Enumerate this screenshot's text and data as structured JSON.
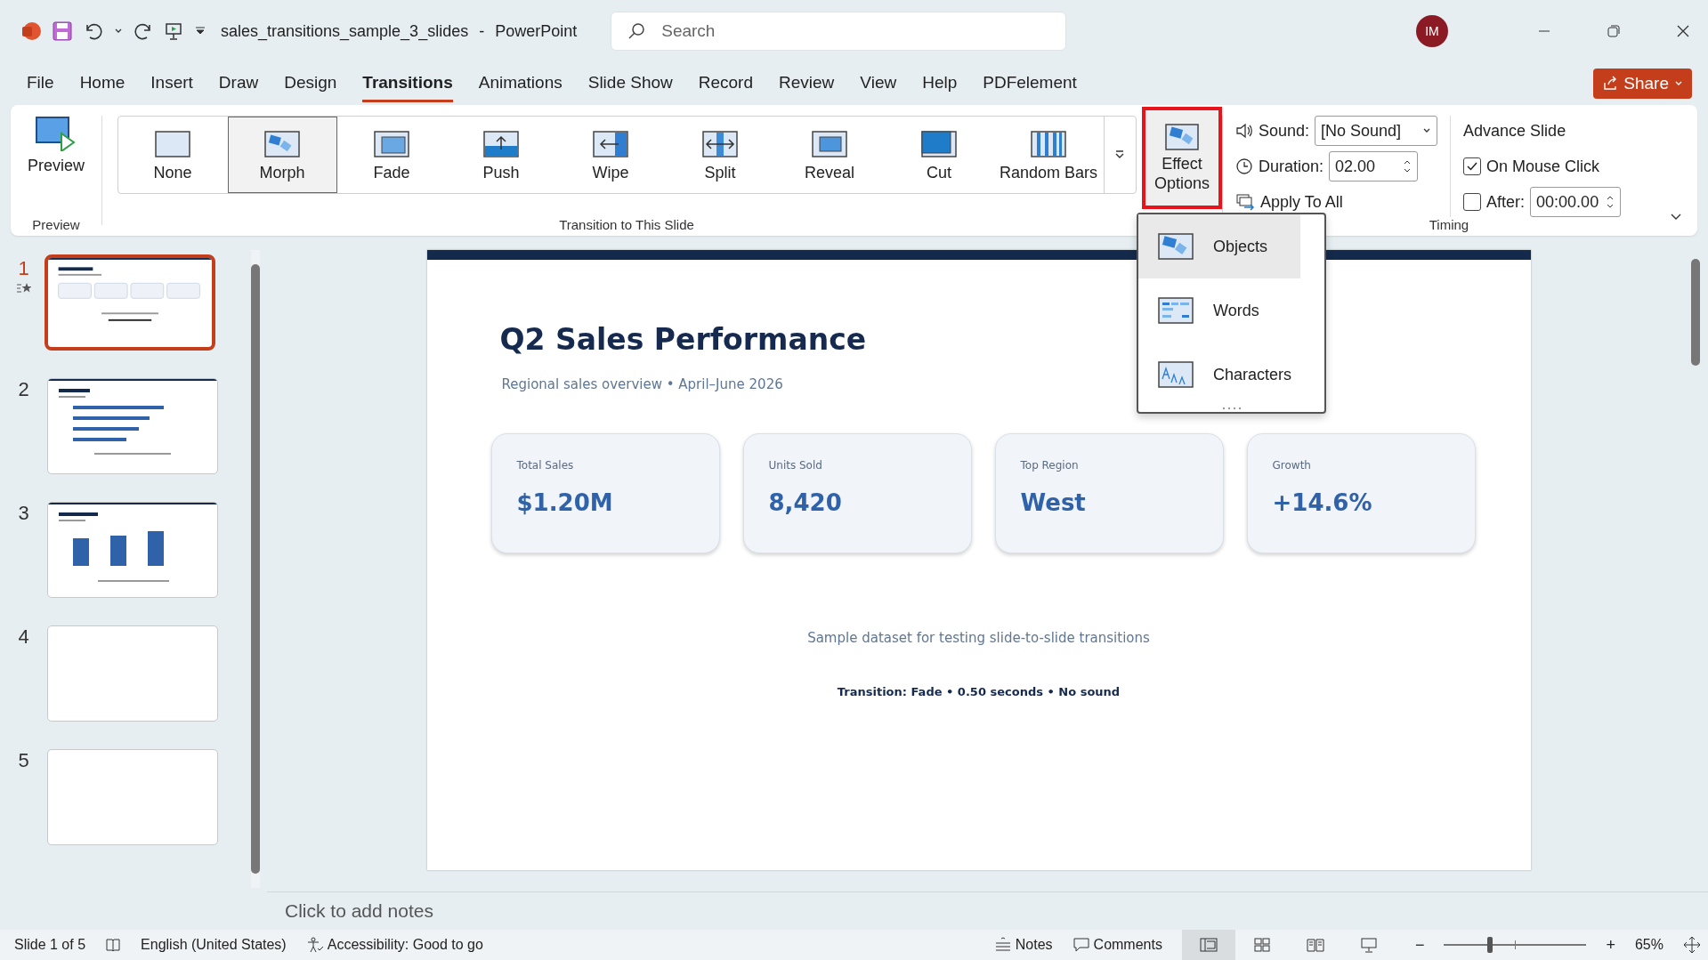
{
  "title_bar": {
    "file_name": "sales_transitions_sample_3_slides",
    "separator": "-",
    "app": "PowerPoint",
    "search": {
      "placeholder": "Search"
    },
    "avatar": "IM"
  },
  "menu_tabs": [
    {
      "label": "File",
      "selected": false
    },
    {
      "label": "Home",
      "selected": false
    },
    {
      "label": "Insert",
      "selected": false
    },
    {
      "label": "Draw",
      "selected": false
    },
    {
      "label": "Design",
      "selected": false
    },
    {
      "label": "Transitions",
      "selected": true
    },
    {
      "label": "Animations",
      "selected": false
    },
    {
      "label": "Slide Show",
      "selected": false
    },
    {
      "label": "Record",
      "selected": false
    },
    {
      "label": "Review",
      "selected": false
    },
    {
      "label": "View",
      "selected": false
    },
    {
      "label": "Help",
      "selected": false
    },
    {
      "label": "PDFelement",
      "selected": false
    }
  ],
  "share": "Share",
  "ribbon": {
    "preview": {
      "label": "Preview",
      "group": "Preview"
    },
    "transitions": [
      {
        "label": "None",
        "kind": "none",
        "selected": false
      },
      {
        "label": "Morph",
        "kind": "morph",
        "selected": true
      },
      {
        "label": "Fade",
        "kind": "fade",
        "selected": false
      },
      {
        "label": "Push",
        "kind": "push",
        "selected": false
      },
      {
        "label": "Wipe",
        "kind": "wipe",
        "selected": false
      },
      {
        "label": "Split",
        "kind": "split",
        "selected": false
      },
      {
        "label": "Reveal",
        "kind": "reveal",
        "selected": false
      },
      {
        "label": "Cut",
        "kind": "cut",
        "selected": false
      },
      {
        "label": "Random Bars",
        "kind": "bars",
        "selected": false
      }
    ],
    "group": "Transition to This Slide",
    "effect_options": {
      "label": "Effect Options",
      "expanded": true
    },
    "timing": {
      "sound_label": "Sound:",
      "sound_value": "[No Sound]",
      "duration_label": "Duration:",
      "duration_value": "02.00",
      "apply_all": "Apply To All",
      "advance": "Advance Slide",
      "on_mouse_click": {
        "label": "On Mouse Click",
        "checked": true
      },
      "after": {
        "label": "After:",
        "checked": false,
        "value": "00:00.00"
      },
      "group": "Timing"
    }
  },
  "effect_menu": [
    {
      "label": "Objects",
      "kind": "objects",
      "selected": true
    },
    {
      "label": "Words",
      "kind": "words",
      "selected": false
    },
    {
      "label": "Characters",
      "kind": "characters",
      "selected": false
    }
  ],
  "slides": [
    {
      "number": "1",
      "kind": "summary",
      "selected": true,
      "has_transition": true
    },
    {
      "number": "2",
      "kind": "bars",
      "selected": false,
      "has_transition": false
    },
    {
      "number": "3",
      "kind": "columns",
      "selected": false,
      "has_transition": false
    },
    {
      "number": "4",
      "kind": "blank",
      "selected": false,
      "has_transition": false
    },
    {
      "number": "5",
      "kind": "blank",
      "selected": false,
      "has_transition": false
    }
  ],
  "slide": {
    "title": "Q2 Sales Performance",
    "subtitle": "Regional sales overview • April–June 2026",
    "cards": [
      {
        "label": "Total Sales",
        "value": "$1.20M"
      },
      {
        "label": "Units Sold",
        "value": "8,420"
      },
      {
        "label": "Top Region",
        "value": "West"
      },
      {
        "label": "Growth",
        "value": "+14.6%"
      }
    ],
    "note": "Sample dataset for testing slide-to-slide transitions",
    "transition_info": "Transition: Fade • 0.50 seconds • No sound"
  },
  "notes": {
    "placeholder": "Click to add notes"
  },
  "status_bar": {
    "slide": "Slide 1 of 5",
    "language": "English (United States)",
    "accessibility": "Accessibility: Good to go",
    "notes": "Notes",
    "comments": "Comments",
    "views": [
      {
        "kind": "normal",
        "selected": true
      },
      {
        "kind": "sorter",
        "selected": false
      },
      {
        "kind": "reading",
        "selected": false
      },
      {
        "kind": "slideshow",
        "selected": false
      }
    ],
    "zoom_out": "−",
    "zoom_in": "+",
    "zoom": {
      "level": 0.32
    },
    "zoom_text": "65%"
  }
}
